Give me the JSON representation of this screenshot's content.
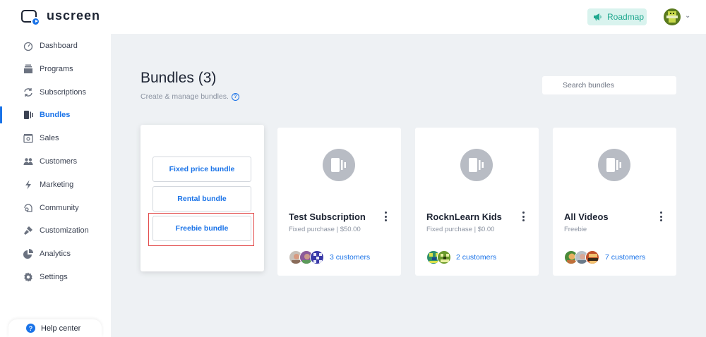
{
  "app": {
    "name": "uscreen"
  },
  "topbar": {
    "roadmap_label": "Roadmap"
  },
  "sidebar": {
    "items": [
      {
        "label": "Dashboard",
        "icon": "dashboard-icon",
        "active": false
      },
      {
        "label": "Programs",
        "icon": "programs-icon",
        "active": false
      },
      {
        "label": "Subscriptions",
        "icon": "subscriptions-icon",
        "active": false
      },
      {
        "label": "Bundles",
        "icon": "bundles-icon",
        "active": true
      },
      {
        "label": "Sales",
        "icon": "sales-icon",
        "active": false
      },
      {
        "label": "Customers",
        "icon": "customers-icon",
        "active": false
      },
      {
        "label": "Marketing",
        "icon": "marketing-icon",
        "active": false
      },
      {
        "label": "Community",
        "icon": "community-icon",
        "active": false
      },
      {
        "label": "Customization",
        "icon": "customization-icon",
        "active": false
      },
      {
        "label": "Analytics",
        "icon": "analytics-icon",
        "active": false
      },
      {
        "label": "Settings",
        "icon": "settings-icon",
        "active": false
      }
    ],
    "help_label": "Help center"
  },
  "main": {
    "title": "Bundles (3)",
    "subtitle": "Create & manage bundles.",
    "search_placeholder": "Search bundles",
    "create_options": {
      "fixed": "Fixed price bundle",
      "rental": "Rental bundle",
      "freebie": "Freebie bundle"
    },
    "bundles": [
      {
        "title": "Test Subscription",
        "meta": "Fixed purchase | $50.00",
        "customers": "3 customers"
      },
      {
        "title": "RocknLearn Kids",
        "meta": "Fixed purchase | $0.00",
        "customers": "2 customers"
      },
      {
        "title": "All Videos",
        "meta": "Freebie",
        "customers": "7 customers"
      }
    ]
  },
  "colors": {
    "accent": "#1a73e8",
    "background": "#eef1f4",
    "roadmap_bg": "#d9f3ee",
    "roadmap_text": "#1fa88f",
    "highlight_border": "#e24a4a"
  }
}
